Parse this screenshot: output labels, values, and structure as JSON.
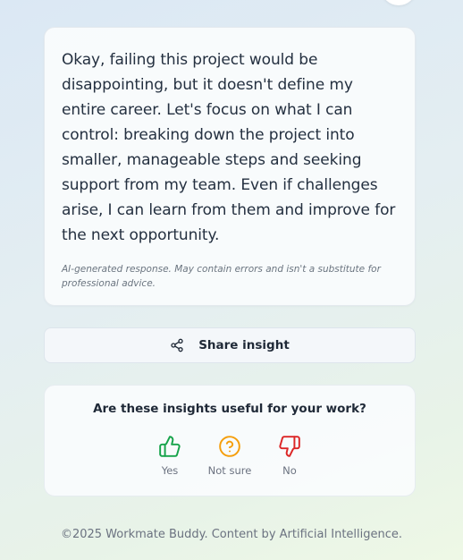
{
  "response": {
    "text": "Okay, failing this project would be disappointing, but it doesn't define my entire career. Let's focus on what I can control: breaking down the project into smaller, manageable steps and seeking support from my team. Even if challenges arise, I can learn from them and improve for the next opportunity.",
    "disclaimer": "AI-generated response. May contain errors and isn't a substitute for professional advice."
  },
  "share": {
    "label": "Share insight",
    "icon": "share-icon"
  },
  "feedback": {
    "question": "Are these insights useful for your work?",
    "options": [
      {
        "label": "Yes",
        "icon": "thumbs-up-icon",
        "color": "#16a34a"
      },
      {
        "label": "Not sure",
        "icon": "question-circle-icon",
        "color": "#f59e0b"
      },
      {
        "label": "No",
        "icon": "thumbs-down-icon",
        "color": "#dc2626"
      }
    ]
  },
  "footer": {
    "text": "©2025 Workmate Buddy. Content by Artificial Intelligence."
  }
}
